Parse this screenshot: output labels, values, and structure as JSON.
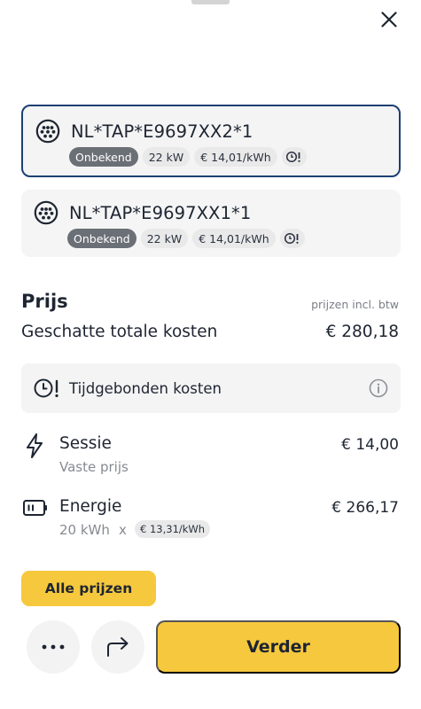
{
  "connectors": [
    {
      "id": "NL*TAP*E9697XX2*1",
      "status": "Onbekend",
      "power": "22 kW",
      "rate": "€ 14,01/kWh",
      "selected": true
    },
    {
      "id": "NL*TAP*E9697XX1*1",
      "status": "Onbekend",
      "power": "22 kW",
      "rate": "€ 14,01/kWh",
      "selected": false
    }
  ],
  "pricing": {
    "title": "Prijs",
    "note": "prijzen incl. btw",
    "total_label": "Geschatte totale kosten",
    "total_value": "€ 280,18",
    "time_bound_label": "Tijdgebonden kosten",
    "session": {
      "title": "Sessie",
      "subtitle": "Vaste prijs",
      "value": "€ 14,00"
    },
    "energy": {
      "title": "Energie",
      "amount": "20 kWh",
      "times": "x",
      "rate": "€ 13,31/kWh",
      "value": "€ 266,17"
    }
  },
  "actions": {
    "all_prices": "Alle prijzen",
    "next": "Verder"
  },
  "colors": {
    "accent": "#f6c83d",
    "selected_border": "#1d3f73",
    "status_badge": "#6b6f76"
  }
}
